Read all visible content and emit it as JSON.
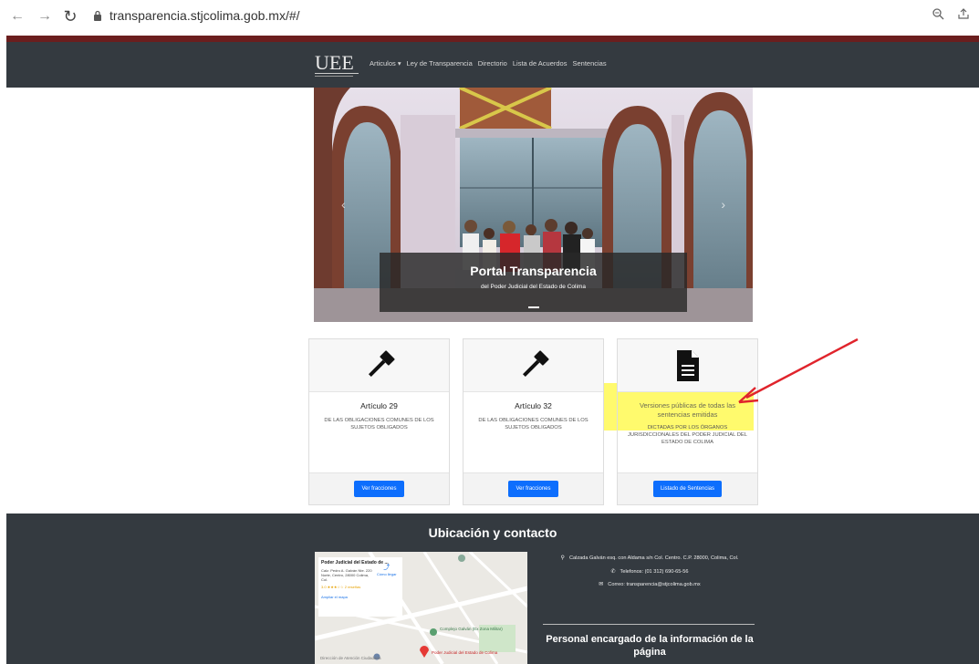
{
  "browser": {
    "url": "transparencia.stjcolima.gob.mx/#/"
  },
  "nav": {
    "logo_text": "UEE",
    "links": [
      "Articulos",
      "Ley de Transparencia",
      "Directorio",
      "Lista de Acuerdos",
      "Sentencias"
    ]
  },
  "hero": {
    "title": "Portal Transparencia",
    "subtitle": "del Poder Judicial del Estado de Colima"
  },
  "cards": [
    {
      "title": "Artículo 29",
      "desc": "DE LAS OBLIGACIONES COMUNES DE LOS SUJETOS OBLIGADOS",
      "button": "Ver fracciones",
      "icon": "gavel-icon"
    },
    {
      "title": "Artículo 32",
      "desc": "DE LAS OBLIGACIONES COMUNES DE LOS SUJETOS OBLIGADOS",
      "button": "Ver fracciones",
      "icon": "gavel-icon"
    },
    {
      "title": "Versiones públicas de todas las sentencias emitidas",
      "desc": "DICTADAS POR LOS ÓRGANOS JURISDICCIONALES DEL PODER JUDICIAL DEL ESTADO DE COLIMA",
      "button": "Listado de Sentencias",
      "icon": "document-icon"
    }
  ],
  "footer": {
    "heading": "Ubicación y contacto",
    "address": "Calzada Galván esq. con Aldama s/n Col. Centro. C.P. 28000, Colima, Col.",
    "phone": "Telefonos: (01 312) 690-65-56",
    "email": "Correo: transparencia@stjcolima.gob.mx",
    "person_heading": "Personal encargado de la información de la página"
  },
  "map": {
    "place": "Poder Judicial del Estado de ...",
    "address": "Calz. Pedro A. Galván Nte. 220 Norte, Centro, 28000 Colima, Col.",
    "rating": "3.0 ★★★☆☆  2 reseñas",
    "directions": "Cómo llegar",
    "expand": "Ampliar el mapa",
    "poi_1": "Complejo Galván (Ex Zona Militar)",
    "poi_2": "Poder Judicial del Estado de Colima",
    "poi_3": "Dirección de Atención Ciudadana"
  },
  "colors": {
    "navbar": "#343a40",
    "accent": "#0d6efd",
    "top_bar": "#6b1e1e",
    "highlight": "#fff83c",
    "annotation_arrow": "#e0242c"
  }
}
